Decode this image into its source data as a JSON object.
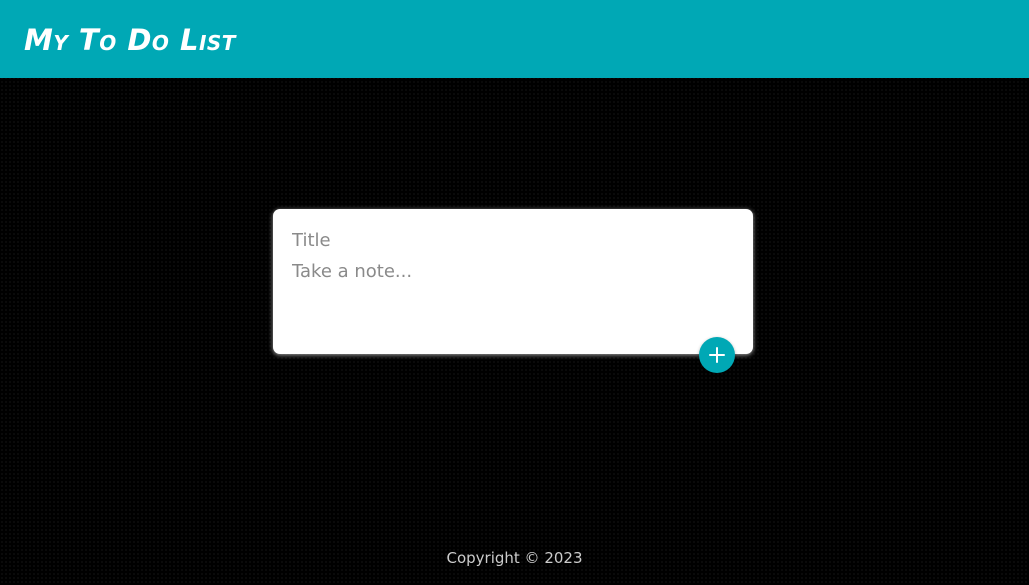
{
  "header": {
    "title": "My To Do List"
  },
  "note_form": {
    "title_placeholder": "Title",
    "content_placeholder": "Take a note...",
    "add_icon": "plus-icon"
  },
  "footer": {
    "copyright": "Copyright © 2023"
  },
  "colors": {
    "accent": "#00a8b5",
    "background": "#000000",
    "card": "#ffffff"
  }
}
